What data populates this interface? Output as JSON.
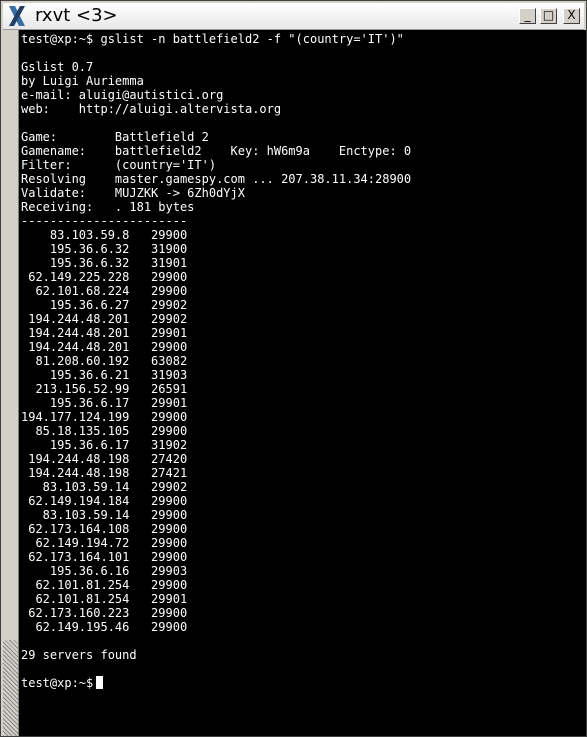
{
  "window": {
    "title": "rxvt <3>",
    "app_icon": "x-logo-icon",
    "controls": {
      "minimize": "_",
      "maximize": "□",
      "close": "X"
    }
  },
  "terminal": {
    "lines": [
      "test@xp:~$ gslist -n battlefield2 -f \"(country='IT')\"",
      "",
      "Gslist 0.7",
      "by Luigi Auriemma",
      "e-mail: aluigi@autistici.org",
      "web:    http://aluigi.altervista.org",
      "",
      "Game:        Battlefield 2",
      "Gamename:    battlefield2    Key: hW6m9a    Enctype: 0",
      "Filter:      (country='IT')",
      "Resolving    master.gamespy.com ... 207.38.11.34:28900",
      "Validate:    MUJZKK -> 6Zh0dYjX",
      "Receiving:   . 181 bytes",
      "-----------------------",
      "    83.103.59.8   29900",
      "    195.36.6.32   31900",
      "    195.36.6.32   31901",
      " 62.149.225.228   29900",
      "  62.101.68.224   29900",
      "    195.36.6.27   29902",
      " 194.244.48.201   29902",
      " 194.244.48.201   29901",
      " 194.244.48.201   29900",
      "  81.208.60.192   63082",
      "    195.36.6.21   31903",
      "  213.156.52.99   26591",
      "    195.36.6.17   29901",
      "194.177.124.199   29900",
      "  85.18.135.105   29900",
      "    195.36.6.17   31902",
      " 194.244.48.198   27420",
      " 194.244.48.198   27421",
      "   83.103.59.14   29902",
      " 62.149.194.184   29900",
      "   83.103.59.14   29900",
      " 62.173.164.108   29900",
      "  62.149.194.72   29900",
      " 62.173.164.101   29900",
      "    195.36.6.16   29903",
      "  62.101.81.254   29900",
      "  62.101.81.254   29901",
      " 62.173.160.223   29900",
      "  62.149.195.46   29900",
      "",
      "29 servers found"
    ],
    "prompt": "test@xp:~$"
  },
  "colors": {
    "terminal_bg": "#000000",
    "terminal_fg": "#ffffff",
    "chrome": "#d4d0c8"
  }
}
